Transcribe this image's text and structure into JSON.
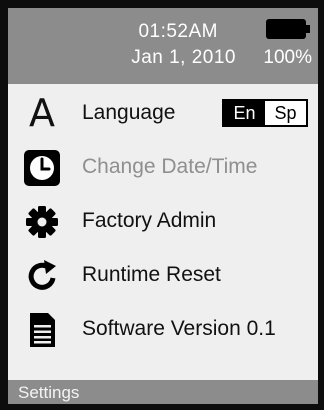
{
  "status": {
    "time": "01:52AM",
    "date": "Jan 1, 2010",
    "battery_percent": "100%",
    "battery_level": 1.0
  },
  "menu": {
    "items": [
      {
        "label": "Language",
        "icon": "letter-a-icon",
        "options": [
          "En",
          "Sp"
        ],
        "selected": "En"
      },
      {
        "label": "Change Date/Time",
        "icon": "clock-icon",
        "state": "disabled"
      },
      {
        "label": "Factory Admin",
        "icon": "gear-icon"
      },
      {
        "label": "Runtime Reset",
        "icon": "refresh-icon"
      },
      {
        "label": "Software Version 0.1",
        "icon": "document-icon"
      }
    ]
  },
  "footer": {
    "title": "Settings"
  },
  "colors": {
    "bar": "#8c8c8c",
    "screen": "#efefef",
    "text": "#111111",
    "dim_text": "#8f8f8f"
  },
  "icon_glyphs": {
    "language": "A"
  }
}
